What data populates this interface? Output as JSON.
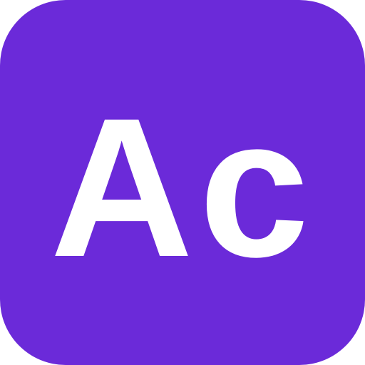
{
  "app_icon": {
    "label": "Ac",
    "background_color": "#6b2ad9",
    "text_color": "#ffffff"
  }
}
